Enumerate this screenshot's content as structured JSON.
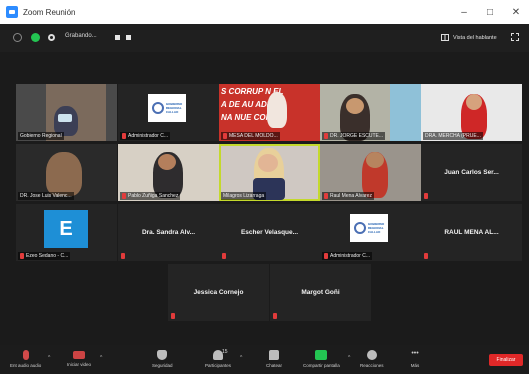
{
  "window": {
    "title": "Zoom Reunión",
    "minimize": "–",
    "maximize": "□",
    "close": "✕"
  },
  "topbar": {
    "status": "Grabando...",
    "view_label": "Vista del hablante"
  },
  "participants": {
    "p1": "Gobierno Regional",
    "p2": "Administrador C...",
    "p3": "MESA DEL MOLDO...",
    "p4": "DR. JORGE ESCUTE...",
    "p5": "DRA. MERCHA (PRUE...",
    "p6": "DR. Jose Luis Valenc...",
    "p7": "Pablo Zuñiga Sanchez",
    "p8": "Milagros Lizarraga",
    "p9": "Raul Mena Alvarez",
    "p10": "Juan Carlos Ser...",
    "p11": "Ezeo Sedano - C...",
    "p12": "Dra. Sandra Alv...",
    "p13": "Escher Velasque...",
    "p14": "Administrador C...",
    "p15": "RAUL MENA AL...",
    "p16": "Jessica Cornejo",
    "p17": "Margot Goñi"
  },
  "banner": {
    "line1": "S CORRUP   N EL",
    "line2": "A DE AU   ADES",
    "line3": "NA NUE   CONST"
  },
  "logo": {
    "line1": "GOBIERNO",
    "line2": "REGIONAL",
    "line3": "CALLAO"
  },
  "avatar_letter": "E",
  "toolbar": {
    "audio": "Ent audio audio",
    "video": "Iniciar video",
    "security": "Seguridad",
    "participants": "Participantes",
    "participants_count": "15",
    "chat": "Chatear",
    "share": "Compartir pantalla",
    "reactions": "Reacciones",
    "more": "Más",
    "end": "Finalizar"
  },
  "colors": {
    "accent_blue": "#2d8cff",
    "active_speaker": "#c4d92c",
    "end_red": "#e02828",
    "share_green": "#23c552",
    "mute_red": "#e23b3b"
  }
}
